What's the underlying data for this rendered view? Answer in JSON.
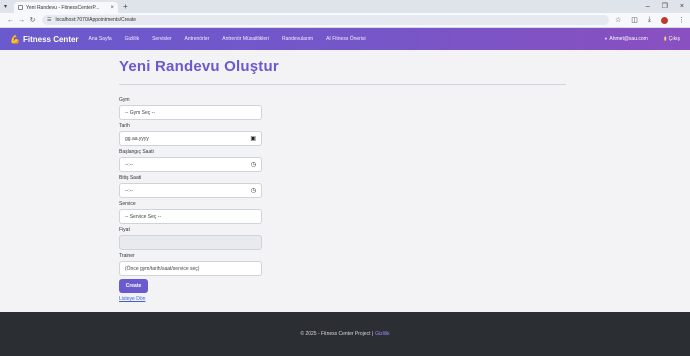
{
  "browser": {
    "tab_title": "Yeni Randevu - FitnessCenterP...",
    "tab_close": "×",
    "new_tab": "+",
    "url": "localhost:7070/Appointments/Create",
    "win_minimize": "–",
    "win_maximize": "❐",
    "win_close": "×"
  },
  "navbar": {
    "brand": "Fitness Center",
    "links": [
      "Ana Sayfa",
      "Gizlilik",
      "Servisler",
      "Antrenörler",
      "Antrenör Müsaitlikleri",
      "Randevularım",
      "AI Fitness Önerisi"
    ],
    "user": "Ahmet@sau.com",
    "logout": "Çıkış"
  },
  "main": {
    "title": "Yeni Randevu Oluştur",
    "fields": {
      "gym": {
        "label": "Gym",
        "value": "-- Gym Seç --"
      },
      "date": {
        "label": "Tarih",
        "value": "gg.aa.yyyy"
      },
      "start_time": {
        "label": "Başlangıç Saati",
        "value": "--:--"
      },
      "end_time": {
        "label": "Bitiş Saati",
        "value": "--:--"
      },
      "service": {
        "label": "Service",
        "value": "-- Service Seç --"
      },
      "price": {
        "label": "Fiyat",
        "value": ""
      },
      "trainer": {
        "label": "Trainer",
        "value": "(Önce gym/tarih/saat/service seç)"
      }
    },
    "create_button": "Create",
    "back_link": "Listeye Dön"
  },
  "footer": {
    "text": "© 2025 - Fitness Center Project |",
    "privacy": "Gizlilik"
  },
  "colors": {
    "accent": "#6a5acd",
    "navbar_end": "#8a4fc0",
    "footer_bg": "#2b2e33",
    "link": "#3b63d6"
  }
}
